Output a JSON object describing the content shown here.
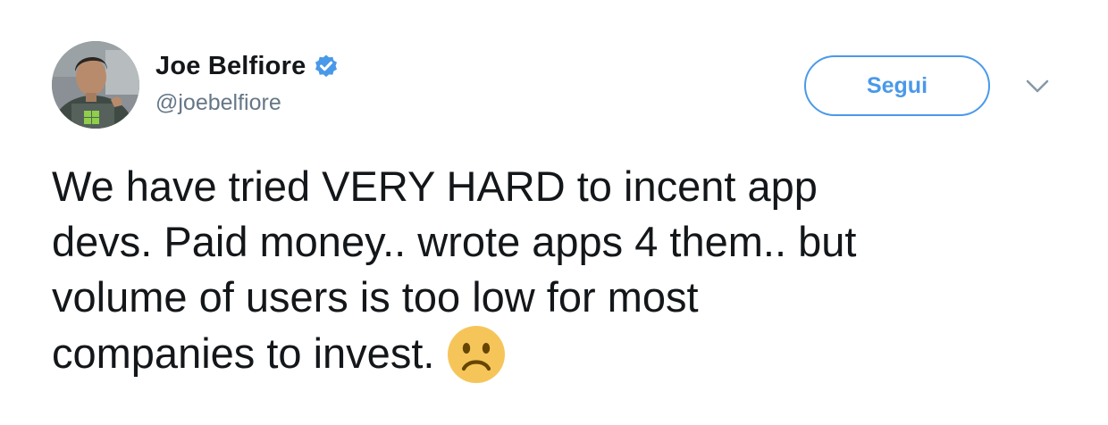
{
  "author": {
    "display_name": "Joe Belfiore",
    "handle": "@joebelfiore",
    "verified": true,
    "avatar_icon": "profile-photo"
  },
  "actions": {
    "follow_label": "Segui",
    "more_icon": "chevron-down-icon"
  },
  "tweet": {
    "lines": [
      "We have tried VERY HARD to incent app",
      "devs. Paid money.. wrote apps 4 them.. but",
      "volume of users is too low for most",
      "companies to invest."
    ],
    "emoji": "slightly-frowning-face"
  },
  "colors": {
    "accent": "#4a99e9",
    "text": "#14171a",
    "secondary_text": "#657786",
    "emoji_face": "#f6c55a"
  }
}
